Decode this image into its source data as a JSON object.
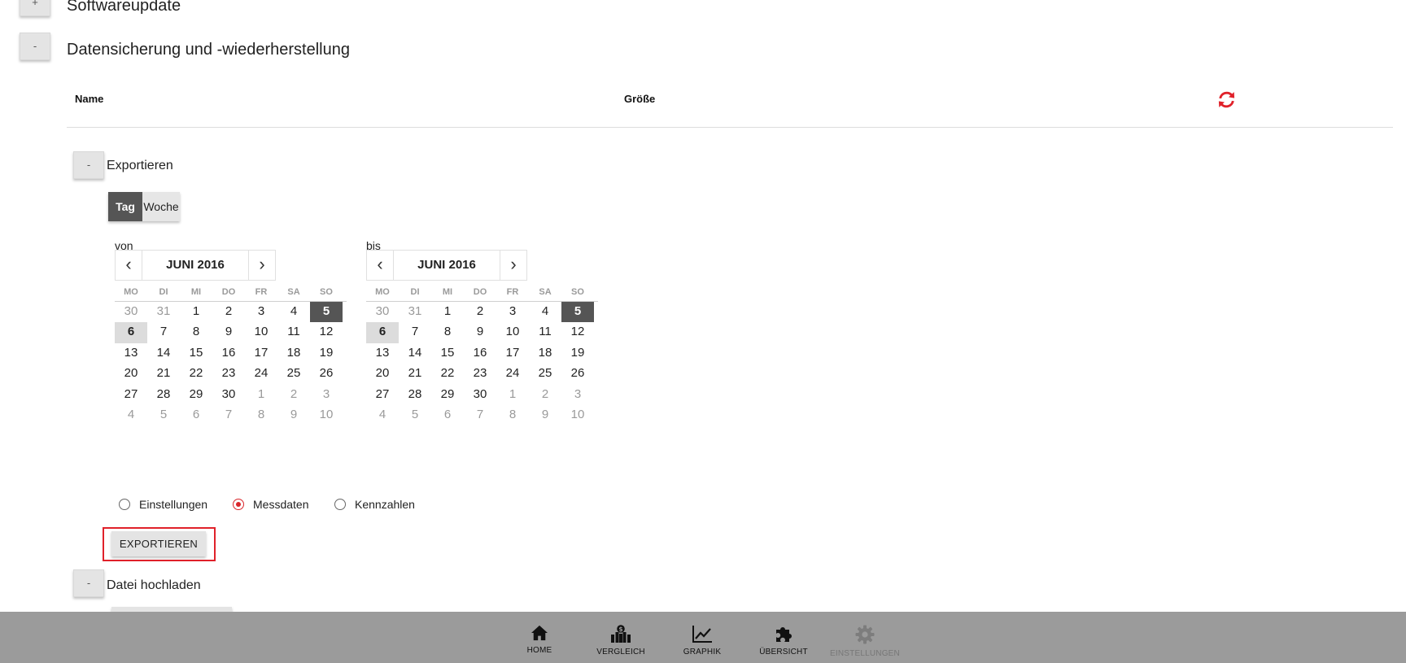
{
  "sections": {
    "softwareupdate": {
      "toggle": "+",
      "title": "Softwareupdate"
    },
    "backup": {
      "toggle": "-",
      "title": "Datensicherung und -wiederherstellung"
    }
  },
  "table": {
    "col_name": "Name",
    "col_size": "Größe",
    "refresh_icon": "refresh-icon"
  },
  "export": {
    "toggle": "-",
    "title": "Exportieren",
    "period": {
      "tag": "Tag",
      "woche": "Woche",
      "selected": "Tag"
    },
    "from": {
      "label": "von",
      "month": "JUNI 2016",
      "weekdays": [
        "MO",
        "DI",
        "MI",
        "DO",
        "FR",
        "SA",
        "SO"
      ],
      "weeks": [
        [
          "30",
          "31",
          "1",
          "2",
          "3",
          "4",
          "5"
        ],
        [
          "6",
          "7",
          "8",
          "9",
          "10",
          "11",
          "12"
        ],
        [
          "13",
          "14",
          "15",
          "16",
          "17",
          "18",
          "19"
        ],
        [
          "20",
          "21",
          "22",
          "23",
          "24",
          "25",
          "26"
        ],
        [
          "27",
          "28",
          "29",
          "30",
          "1",
          "2",
          "3"
        ],
        [
          "4",
          "5",
          "6",
          "7",
          "8",
          "9",
          "10"
        ]
      ],
      "selected": "5",
      "today": "6"
    },
    "to": {
      "label": "bis",
      "month": "JUNI 2016",
      "weekdays": [
        "MO",
        "DI",
        "MI",
        "DO",
        "FR",
        "SA",
        "SO"
      ],
      "weeks": [
        [
          "30",
          "31",
          "1",
          "2",
          "3",
          "4",
          "5"
        ],
        [
          "6",
          "7",
          "8",
          "9",
          "10",
          "11",
          "12"
        ],
        [
          "13",
          "14",
          "15",
          "16",
          "17",
          "18",
          "19"
        ],
        [
          "20",
          "21",
          "22",
          "23",
          "24",
          "25",
          "26"
        ],
        [
          "27",
          "28",
          "29",
          "30",
          "1",
          "2",
          "3"
        ],
        [
          "4",
          "5",
          "6",
          "7",
          "8",
          "9",
          "10"
        ]
      ],
      "selected": "5",
      "today": "6"
    },
    "options": [
      {
        "label": "Einstellungen",
        "checked": false
      },
      {
        "label": "Messdaten",
        "checked": true
      },
      {
        "label": "Kennzahlen",
        "checked": false
      }
    ],
    "button": "EXPORTIEREN"
  },
  "upload": {
    "toggle": "-",
    "title": "Datei hochladen"
  },
  "bottom_nav": [
    {
      "label": "HOME",
      "icon": "home-icon",
      "disabled": false
    },
    {
      "label": "VERGLEICH",
      "icon": "comparison-icon",
      "disabled": false
    },
    {
      "label": "GRAPHIK",
      "icon": "line-chart-icon",
      "disabled": false
    },
    {
      "label": "ÜBERSICHT",
      "icon": "puzzle-icon",
      "disabled": false
    },
    {
      "label": "EINSTELLUNGEN",
      "icon": "gear-icon",
      "disabled": true
    }
  ],
  "colors": {
    "accent": "#e0212a",
    "selected_day": "#555555",
    "nav_bar": "#9b9b9b"
  }
}
